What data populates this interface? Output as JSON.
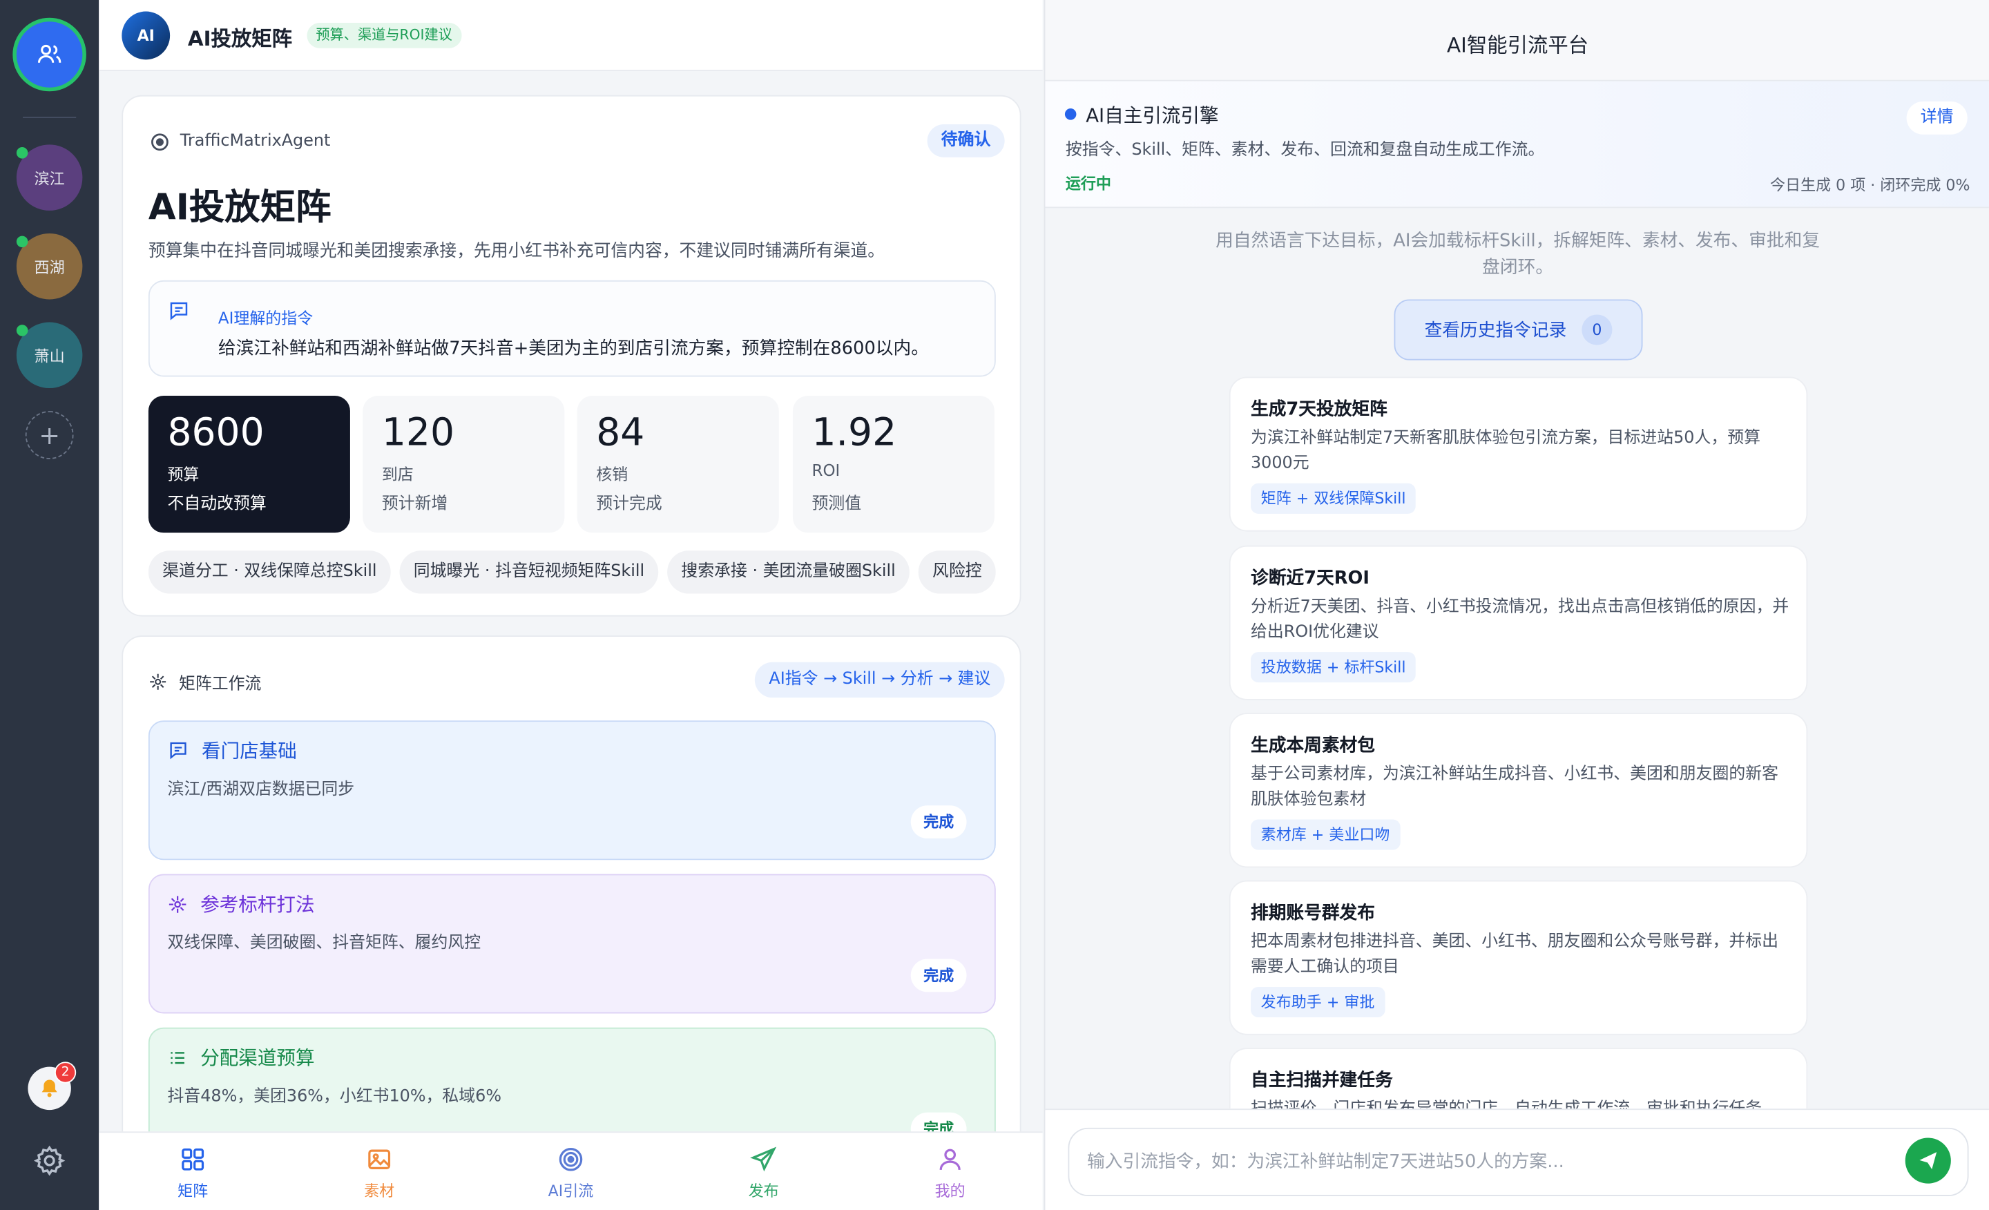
{
  "sidebar": {
    "stores": [
      {
        "label": "滨江",
        "color": "#5b3f7e"
      },
      {
        "label": "西湖",
        "color": "#8a6a3f"
      },
      {
        "label": "萧山",
        "color": "#2a6b78"
      }
    ],
    "add": "+",
    "notifications": "2"
  },
  "left": {
    "header": {
      "logo": "AI",
      "title": "AI投放矩阵",
      "tag": "预算、渠道与ROI建议"
    },
    "summary": {
      "agent": "TrafficMatrixAgent",
      "status": "待确认",
      "title": "AI投放矩阵",
      "desc": "预算集中在抖音同城曝光和美团搜索承接，先用小红书补充可信内容，不建议同时铺满所有渠道。",
      "intent_label": "AI理解的指令",
      "intent_text": "给滨江补鲜站和西湖补鲜站做7天抖音+美团为主的到店引流方案，预算控制在8600以内。",
      "stats": [
        {
          "value": "8600",
          "label": "预算",
          "note": "不自动改预算"
        },
        {
          "value": "120",
          "label": "到店",
          "note": "预计新增"
        },
        {
          "value": "84",
          "label": "核销",
          "note": "预计完成"
        },
        {
          "value": "1.92",
          "label": "ROI",
          "note": "预测值"
        }
      ],
      "skills": [
        "渠道分工 · 双线保障总控Skill",
        "同城曝光 · 抖音短视频矩阵Skill",
        "搜索承接 · 美团流量破圈Skill",
        "风险控"
      ]
    },
    "workflow": {
      "title": "矩阵工作流",
      "flow": "AI指令 → Skill → 分析 → 建议",
      "steps": [
        {
          "title": "看门店基础",
          "desc": "滨江/西湖双店数据已同步",
          "status": "完成"
        },
        {
          "title": "参考标杆打法",
          "desc": "双线保障、美团破圈、抖音矩阵、履约风控",
          "status": "完成"
        },
        {
          "title": "分配渠道预算",
          "desc": "抖音48%，美团36%，小红书10%，私域6%",
          "status": "完成"
        }
      ]
    },
    "tabs": [
      "矩阵",
      "素材",
      "AI引流",
      "发布",
      "我的"
    ]
  },
  "right": {
    "title": "AI智能引流平台",
    "engine": {
      "title": "AI自主引流引擎",
      "desc": "按指令、Skill、矩阵、素材、发布、回流和复盘自动生成工作流。",
      "status": "运行中",
      "stats": "今日生成 0 项 · 闭环完成 0%",
      "detail": "详情"
    },
    "hint": "用自然语言下达目标，AI会加载标杆Skill，拆解矩阵、素材、发布、审批和复盘闭环。",
    "history": {
      "label": "查看历史指令记录",
      "count": "0"
    },
    "commands": [
      {
        "title": "生成7天投放矩阵",
        "desc": "为滨江补鲜站制定7天新客肌肤体验包引流方案，目标进站50人，预算3000元",
        "tag": "矩阵 + 双线保障Skill"
      },
      {
        "title": "诊断近7天ROI",
        "desc": "分析近7天美团、抖音、小红书投流情况，找出点击高但核销低的原因，并给出ROI优化建议",
        "tag": "投放数据 + 标杆Skill"
      },
      {
        "title": "生成本周素材包",
        "desc": "基于公司素材库，为滨江补鲜站生成抖音、小红书、美团和朋友圈的新客肌肤体验包素材",
        "tag": "素材库 + 美业口吻"
      },
      {
        "title": "排期账号群发布",
        "desc": "把本周素材包排进抖音、美团、小红书、朋友圈和公众号账号群，并标出需要人工确认的项目",
        "tag": "发布助手 + 审批"
      },
      {
        "title": "自主扫描并建任务",
        "desc": "扫描评价、门店和发布异常的门店，自动生成工作流、审批和执行任务",
        "tag": ""
      }
    ],
    "input_placeholder": "输入引流指令，如：为滨江补鲜站制定7天进站50人的方案..."
  },
  "colors": {
    "primary": "#2563eb",
    "success": "#1ba74f",
    "purple": "#7c3aed"
  }
}
